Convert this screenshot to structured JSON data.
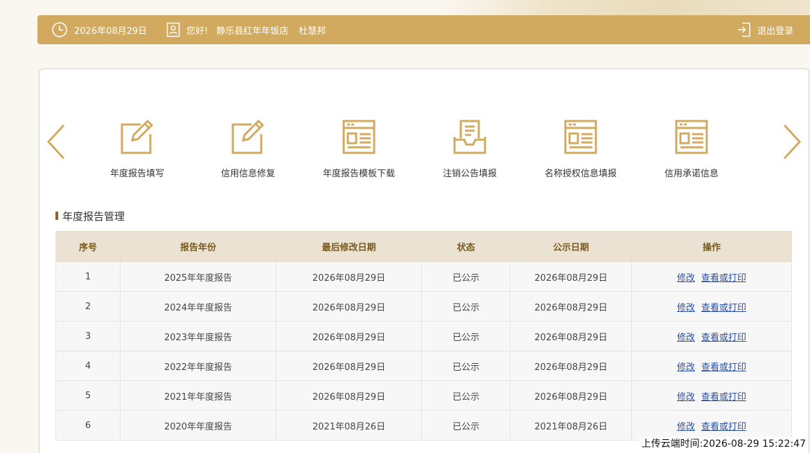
{
  "header": {
    "date": "2026年08月29日",
    "greeting": "您好!",
    "company": "静乐县红年年饭店",
    "person": "杜慧邦",
    "logout_label": "退出登录"
  },
  "features": [
    {
      "label": "年度报告填写",
      "icon": "edit-icon"
    },
    {
      "label": "信用信息修复",
      "icon": "edit-icon"
    },
    {
      "label": "年度报告模板下载",
      "icon": "document-list-icon"
    },
    {
      "label": "注销公告填报",
      "icon": "inbox-document-icon"
    },
    {
      "label": "名称授权信息填报",
      "icon": "document-list-icon"
    },
    {
      "label": "信用承诺信息",
      "icon": "document-list-icon"
    }
  ],
  "section_title": "年度报告管理",
  "table": {
    "headers": [
      "序号",
      "报告年份",
      "最后修改日期",
      "状态",
      "公示日期",
      "操作"
    ],
    "rows": [
      [
        "1",
        "2025年年度报告",
        "2026年08月29日",
        "已公示",
        "2026年08月29日"
      ],
      [
        "2",
        "2024年年度报告",
        "2026年08月29日",
        "已公示",
        "2026年08月29日"
      ],
      [
        "3",
        "2023年年度报告",
        "2026年08月29日",
        "已公示",
        "2026年08月29日"
      ],
      [
        "4",
        "2022年年度报告",
        "2026年08月29日",
        "已公示",
        "2026年08月29日"
      ],
      [
        "5",
        "2021年年度报告",
        "2026年08月29日",
        "已公示",
        "2026年08月29日"
      ],
      [
        "6",
        "2020年年度报告",
        "2021年08月26日",
        "已公示",
        "2021年08月26日"
      ]
    ],
    "actions": {
      "edit": "修改",
      "view": "查看或打印"
    }
  },
  "footer_timestamp": "上传云端时间:2026-08-29 15:22:47",
  "colors": {
    "accent": "#d1aa5f",
    "link": "#2a4fa8",
    "table_header_bg": "#ebe2d3"
  }
}
